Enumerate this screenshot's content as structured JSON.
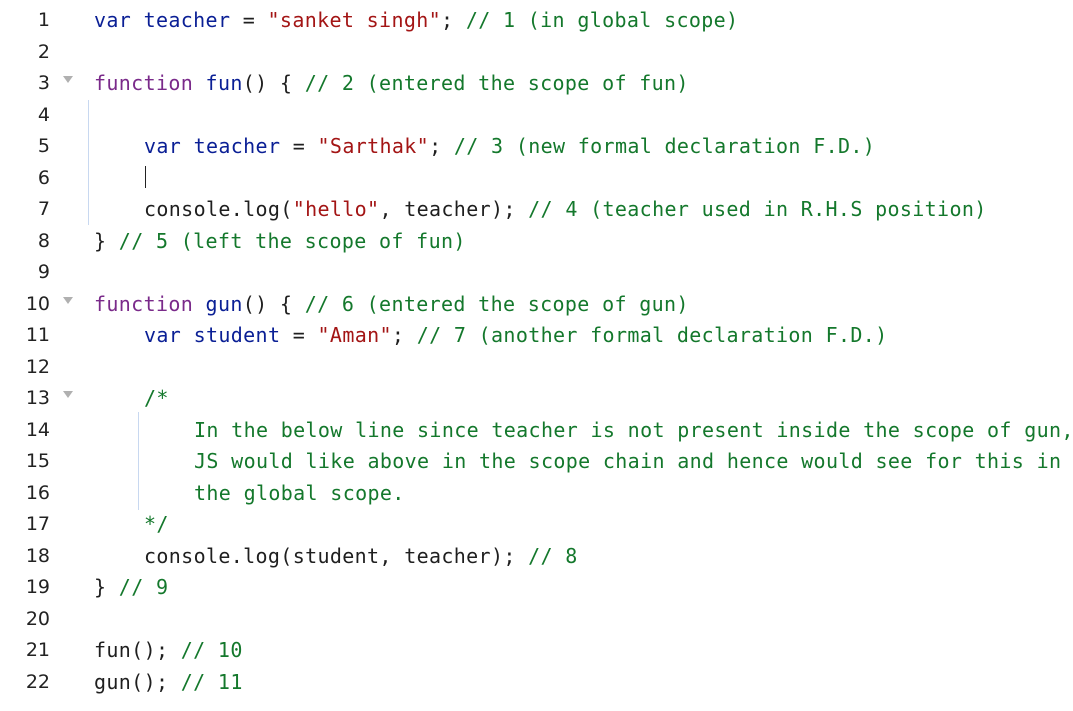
{
  "editor": {
    "lines": [
      {
        "n": "1",
        "fold": false,
        "indent": 0,
        "tokens": [
          [
            "t-var",
            "var"
          ],
          [
            "plain",
            " "
          ],
          [
            "t-name",
            "teacher"
          ],
          [
            "plain",
            " = "
          ],
          [
            "t-str",
            "\"sanket singh\""
          ],
          [
            "plain",
            "; "
          ],
          [
            "t-cm",
            "// 1 (in global scope)"
          ]
        ]
      },
      {
        "n": "2",
        "fold": false,
        "indent": 0,
        "tokens": []
      },
      {
        "n": "3",
        "fold": true,
        "indent": 0,
        "tokens": [
          [
            "t-fnkw",
            "function"
          ],
          [
            "plain",
            " "
          ],
          [
            "t-name",
            "fun"
          ],
          [
            "plain",
            "() { "
          ],
          [
            "t-cm",
            "// 2 (entered the scope of fun)"
          ]
        ]
      },
      {
        "n": "4",
        "fold": false,
        "indent": 0,
        "tokens": []
      },
      {
        "n": "5",
        "fold": false,
        "indent": 1,
        "tokens": [
          [
            "t-var",
            "var"
          ],
          [
            "plain",
            " "
          ],
          [
            "t-name",
            "teacher"
          ],
          [
            "plain",
            " = "
          ],
          [
            "t-str",
            "\"Sarthak\""
          ],
          [
            "plain",
            "; "
          ],
          [
            "t-cm",
            "// 3 (new formal declaration F.D.)"
          ]
        ]
      },
      {
        "n": "6",
        "fold": false,
        "indent": 0,
        "tokens": []
      },
      {
        "n": "7",
        "fold": false,
        "indent": 1,
        "tokens": [
          [
            "plain",
            "console.log("
          ],
          [
            "t-str",
            "\"hello\""
          ],
          [
            "plain",
            ", teacher); "
          ],
          [
            "t-cm",
            "// 4 (teacher used in R.H.S position)"
          ]
        ]
      },
      {
        "n": "8",
        "fold": false,
        "indent": 0,
        "tokens": [
          [
            "plain",
            "} "
          ],
          [
            "t-cm",
            "// 5 (left the scope of fun)"
          ]
        ]
      },
      {
        "n": "9",
        "fold": false,
        "indent": 0,
        "tokens": []
      },
      {
        "n": "10",
        "fold": true,
        "indent": 0,
        "tokens": [
          [
            "t-fnkw",
            "function"
          ],
          [
            "plain",
            " "
          ],
          [
            "t-name",
            "gun"
          ],
          [
            "plain",
            "() { "
          ],
          [
            "t-cm",
            "// 6 (entered the scope of gun)"
          ]
        ]
      },
      {
        "n": "11",
        "fold": false,
        "indent": 1,
        "tokens": [
          [
            "t-var",
            "var"
          ],
          [
            "plain",
            " "
          ],
          [
            "t-name",
            "student"
          ],
          [
            "plain",
            " = "
          ],
          [
            "t-str",
            "\"Aman\""
          ],
          [
            "plain",
            "; "
          ],
          [
            "t-cm",
            "// 7 (another formal declaration F.D.)"
          ]
        ]
      },
      {
        "n": "12",
        "fold": false,
        "indent": 0,
        "tokens": []
      },
      {
        "n": "13",
        "fold": true,
        "indent": 1,
        "tokens": [
          [
            "t-cm",
            "/*"
          ]
        ]
      },
      {
        "n": "14",
        "fold": false,
        "indent": 2,
        "tokens": [
          [
            "t-cm",
            "In the below line since teacher is not present inside the scope of gun,"
          ]
        ]
      },
      {
        "n": "15",
        "fold": false,
        "indent": 2,
        "tokens": [
          [
            "t-cm",
            "JS would like above in the scope chain and hence would see for this in"
          ]
        ]
      },
      {
        "n": "16",
        "fold": false,
        "indent": 2,
        "tokens": [
          [
            "t-cm",
            "the global scope."
          ]
        ]
      },
      {
        "n": "17",
        "fold": false,
        "indent": 1,
        "tokens": [
          [
            "t-cm",
            "*/"
          ]
        ]
      },
      {
        "n": "18",
        "fold": false,
        "indent": 1,
        "tokens": [
          [
            "plain",
            "console.log(student, teacher); "
          ],
          [
            "t-cm",
            "// 8"
          ]
        ]
      },
      {
        "n": "19",
        "fold": false,
        "indent": 0,
        "tokens": [
          [
            "plain",
            "} "
          ],
          [
            "t-cm",
            "// 9"
          ]
        ]
      },
      {
        "n": "20",
        "fold": false,
        "indent": 0,
        "tokens": []
      },
      {
        "n": "21",
        "fold": false,
        "indent": 0,
        "tokens": [
          [
            "plain",
            "fun(); "
          ],
          [
            "t-cm",
            "// 10"
          ]
        ]
      },
      {
        "n": "22",
        "fold": false,
        "indent": 0,
        "tokens": [
          [
            "plain",
            "gun(); "
          ],
          [
            "t-cm",
            "// 11"
          ]
        ]
      }
    ]
  }
}
